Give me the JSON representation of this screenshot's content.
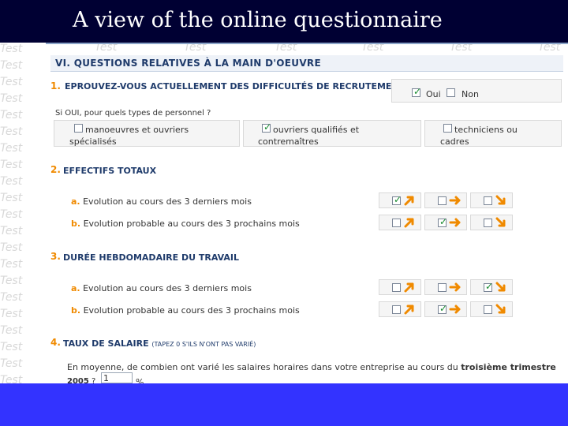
{
  "slide": {
    "title": "A view of the online questionnaire",
    "watermark": "Test"
  },
  "colors": {
    "title_bg": "#000033",
    "bottom_band": "#3333ff",
    "accent": "#f08a00",
    "heading": "#1f3b6b",
    "check": "#178a2e"
  },
  "section": {
    "heading": "VI. QUESTIONS RELATIVES À LA MAIN D'OEUVRE"
  },
  "q1": {
    "number": "1.",
    "title": "EPROUVEZ-VOUS ACTUELLEMENT DES DIFFICULTÉS DE RECRUTEMENT ?",
    "oui_label": "Oui",
    "oui_checked": true,
    "non_label": "Non",
    "non_checked": false,
    "followup": "Si OUI, pour quels types de personnel ?",
    "options": [
      {
        "line1": "manoeuvres et ouvriers",
        "line2": "spécialisés",
        "checked": false
      },
      {
        "line1": "ouvriers qualifiés et",
        "line2": "contremaîtres",
        "checked": true
      },
      {
        "line1": "techniciens ou",
        "line2": "cadres",
        "checked": false
      }
    ]
  },
  "q2": {
    "number": "2.",
    "title": "EFFECTIFS TOTAUX",
    "rows": [
      {
        "letter": "a.",
        "label": "Evolution au cours des 3 derniers mois",
        "selected": "up"
      },
      {
        "letter": "b.",
        "label": "Evolution probable au cours des 3 prochains mois",
        "selected": "stable"
      }
    ]
  },
  "q3": {
    "number": "3.",
    "title": "DURÉE HEBDOMADAIRE DU TRAVAIL",
    "rows": [
      {
        "letter": "a.",
        "label": "Evolution au cours des 3 derniers mois",
        "selected": "down"
      },
      {
        "letter": "b.",
        "label": "Evolution probable au cours des 3 prochains mois",
        "selected": "stable"
      }
    ]
  },
  "q4": {
    "number": "4.",
    "title": "TAUX DE SALAIRE",
    "note": "(TAPEZ 0 S'ILS N'ONT PAS VARIÉ)",
    "question_start": "En moyenne, de combien ont varié les salaires horaires dans votre entreprise au cours du ",
    "question_bold": "troisième trimestre",
    "year": "2005",
    "year_suffix": " ?",
    "value": "1",
    "unit": "%"
  },
  "icons": {
    "up": "arrow-up-right-icon",
    "stable": "arrow-right-icon",
    "down": "arrow-down-right-icon",
    "checkbox": "checkbox-icon"
  }
}
